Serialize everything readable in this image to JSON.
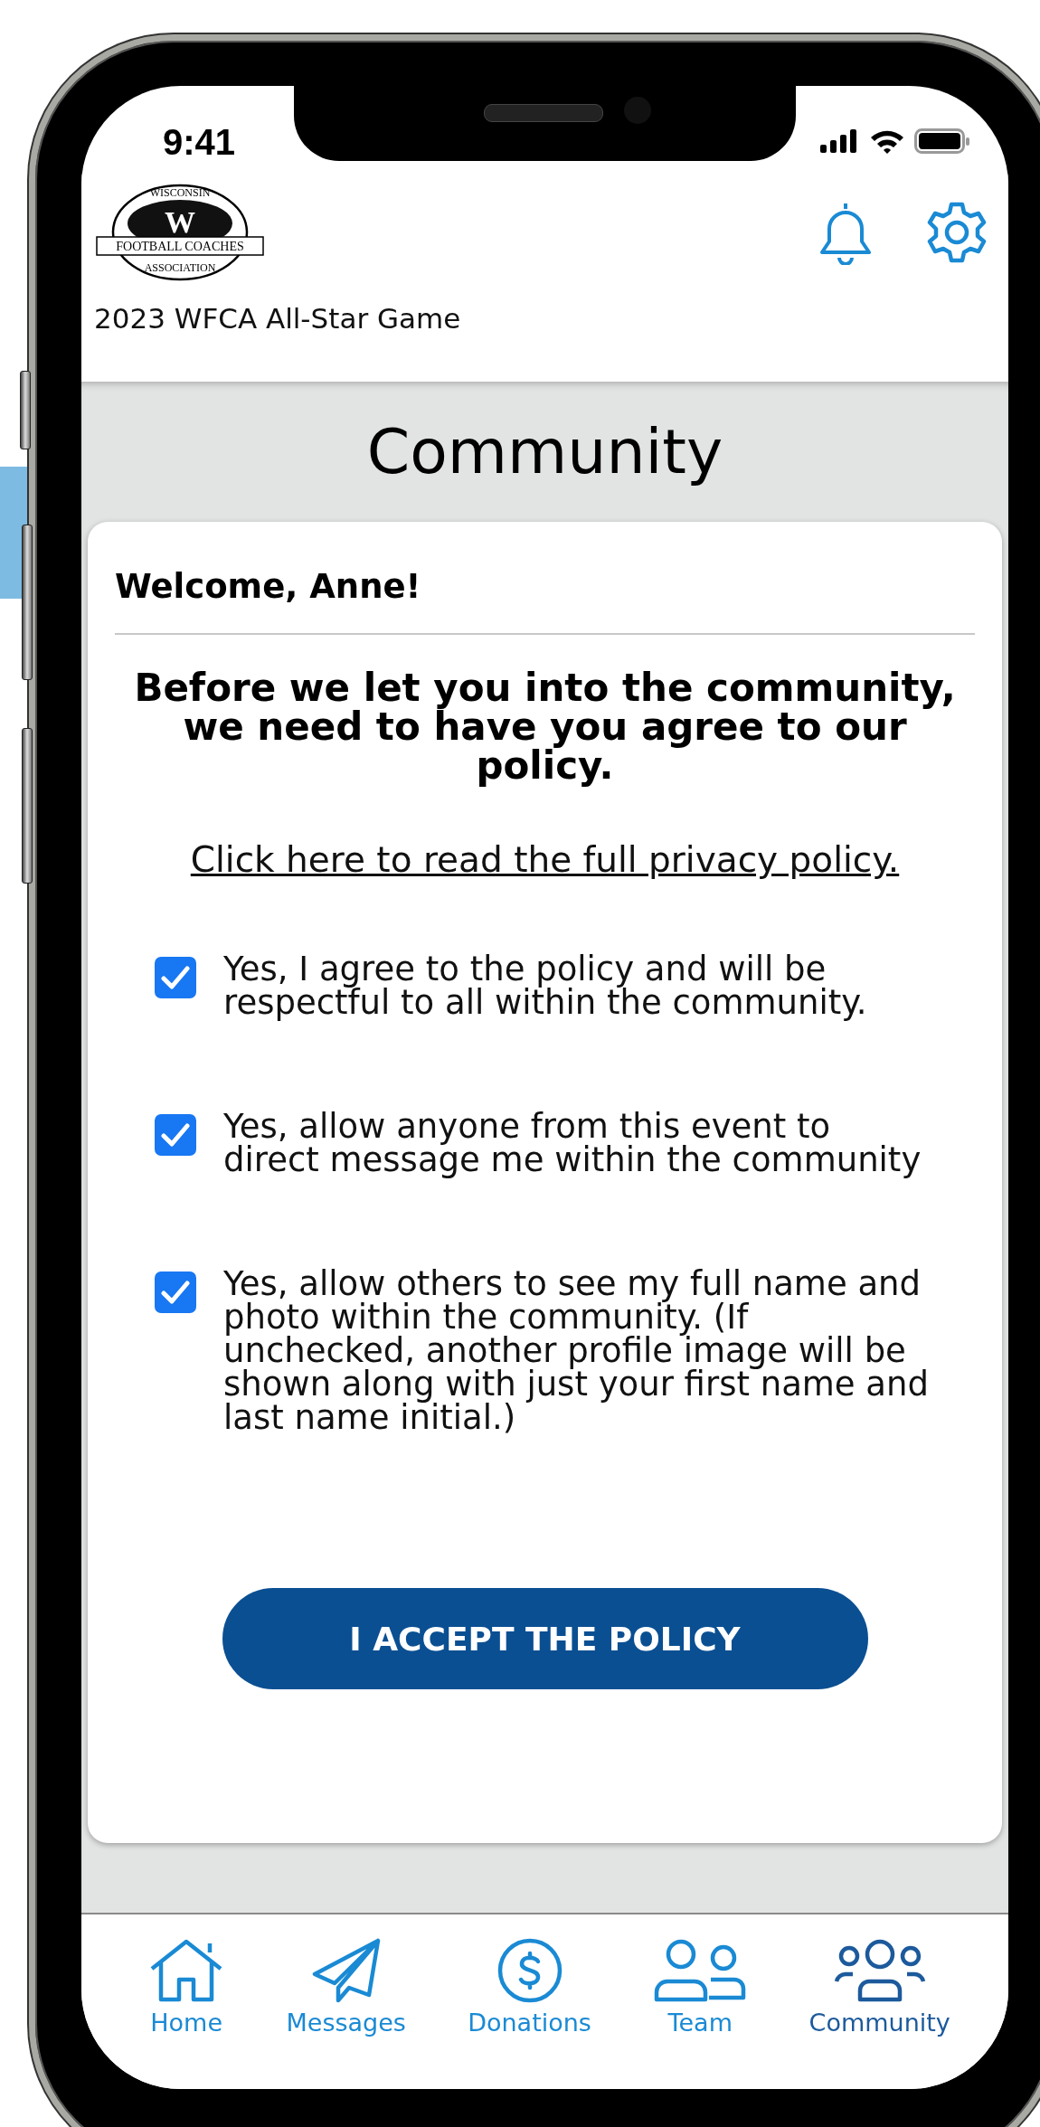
{
  "status_bar": {
    "time": "9:41"
  },
  "logo": {
    "top_text": "WISCONSIN",
    "band_text": "FOOTBALL COACHES",
    "bottom_text": "ASSOCIATION",
    "letter": "W"
  },
  "header": {
    "event_title": "2023 WFCA All-Star Game"
  },
  "page_title": "Community",
  "card": {
    "greeting": "Welcome, Anne!",
    "notice": "Before we let you into the community, we need to have you agree to our policy.",
    "policy_link": "Click here to read the full privacy policy.",
    "consents": [
      {
        "label": "Yes, I agree to the policy and will be respectful to all within the community.",
        "checked": true
      },
      {
        "label": "Yes, allow anyone from this event to direct message me within the community",
        "checked": true
      },
      {
        "label": "Yes, allow others to see my full name and photo within the community. (If unchecked, another profile image will be shown along with just your first name and last name initial.)",
        "checked": true
      }
    ],
    "accept_button": "I ACCEPT THE POLICY"
  },
  "tabs": [
    {
      "label": "Home",
      "selected": false
    },
    {
      "label": "Messages",
      "selected": false
    },
    {
      "label": "Donations",
      "selected": false
    },
    {
      "label": "Team",
      "selected": false
    },
    {
      "label": "Community",
      "selected": true
    }
  ]
}
